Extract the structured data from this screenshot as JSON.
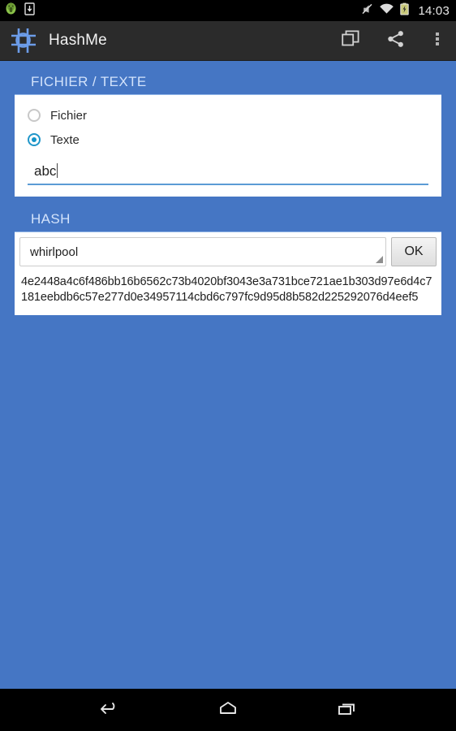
{
  "status_bar": {
    "time": "14:03",
    "icons": [
      "android-robot-icon",
      "usb-debug-icon",
      "ringer-muted-icon",
      "wifi-icon",
      "battery-charging-icon"
    ]
  },
  "action_bar": {
    "app_icon": "hash-grid-icon",
    "title": "HashMe",
    "actions": [
      {
        "name": "copy-button",
        "icon": "copy-icon"
      },
      {
        "name": "share-button",
        "icon": "share-icon"
      },
      {
        "name": "overflow-button",
        "icon": "overflow-menu-icon"
      }
    ]
  },
  "file_text_card": {
    "header": "FICHIER / TEXTE",
    "options": [
      {
        "label": "Fichier",
        "selected": false
      },
      {
        "label": "Texte",
        "selected": true
      }
    ],
    "text_input": {
      "value": "abc",
      "placeholder": ""
    }
  },
  "hash_card": {
    "header": "HASH",
    "algorithm": "whirlpool",
    "ok_label": "OK",
    "result": "4e2448a4c6f486bb16b6562c73b4020bf3043e3a731bce721ae1b303d97e6d4c7181eebdb6c57e277d0e34957114cbd6c797fc9d95d8b582d225292076d4eef5"
  },
  "nav_bar": {
    "buttons": [
      {
        "name": "nav-back-button",
        "icon": "back-arrow-icon"
      },
      {
        "name": "nav-home-button",
        "icon": "home-icon"
      },
      {
        "name": "nav-recents-button",
        "icon": "recents-icon"
      }
    ]
  },
  "colors": {
    "background": "#4576c4",
    "action_bar": "#2b2b2b",
    "accent": "#1494c8",
    "header_text": "#d3e3fb"
  }
}
